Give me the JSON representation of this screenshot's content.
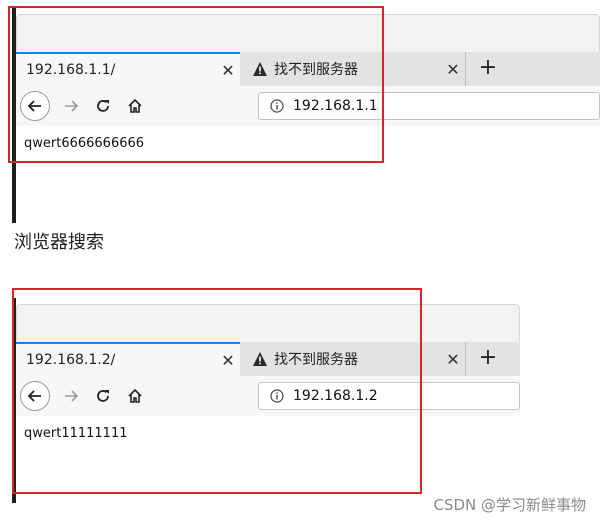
{
  "screenshot_1": {
    "tabs": [
      {
        "label": "192.168.1.1/",
        "active": true
      },
      {
        "label": "找不到服务器",
        "active": false,
        "icon": "warning-icon"
      }
    ],
    "new_tab": "+",
    "url": "192.168.1.1",
    "page_text": "qwert6666666666"
  },
  "caption": "浏览器搜索",
  "screenshot_2": {
    "tabs": [
      {
        "label": "192.168.1.2/",
        "active": true
      },
      {
        "label": "找不到服务器",
        "active": false,
        "icon": "warning-icon"
      }
    ],
    "new_tab": "+",
    "url": "192.168.1.2",
    "page_text": "qwert11111111"
  },
  "watermark": "CSDN @学习新鲜事物",
  "colors": {
    "highlight_box": "#d9242a",
    "tab_accent": "#0a84ff"
  },
  "nav_icons": [
    "back-arrow-icon",
    "forward-arrow-icon",
    "reload-icon",
    "home-icon",
    "info-icon",
    "close-icon"
  ]
}
